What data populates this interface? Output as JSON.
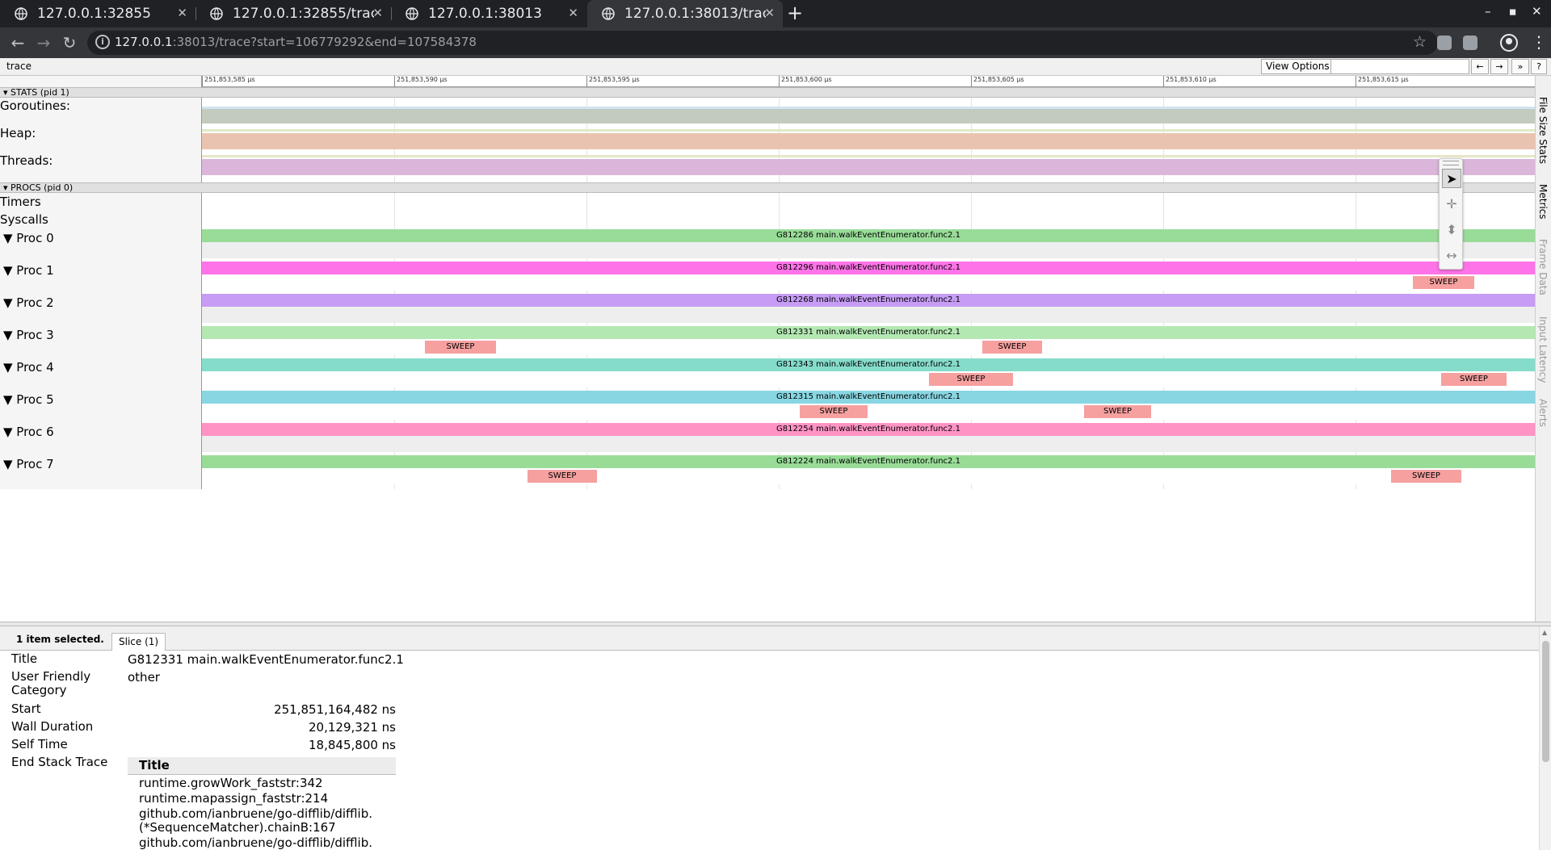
{
  "browser": {
    "tabs": [
      {
        "title": "127.0.0.1:32855",
        "active": false
      },
      {
        "title": "127.0.0.1:32855/trace",
        "active": false
      },
      {
        "title": "127.0.0.1:38013",
        "active": false
      },
      {
        "title": "127.0.0.1:38013/trace",
        "active": true
      }
    ],
    "url_host": "127.0.0.1",
    "url_rest": ":38013/trace?start=106779292&end=107584378"
  },
  "viewer": {
    "title": "trace",
    "view_options_label": "View Options",
    "search_placeholder": "",
    "nav_prev": "←",
    "nav_next": "→",
    "nav_more": "»",
    "help": "?"
  },
  "ruler": {
    "ticks": [
      "251,853,585 µs",
      "251,853,590 µs",
      "251,853,595 µs",
      "251,853,600 µs",
      "251,853,605 µs",
      "251,853,610 µs",
      "251,853,615 µs"
    ]
  },
  "stats": {
    "header": "▾ STATS (pid 1)",
    "goroutines": "Goroutines:",
    "heap": "Heap:",
    "threads": "Threads:"
  },
  "procs": {
    "header": "▾ PROCS (pid 0)",
    "timers": "Timers",
    "syscalls": "Syscalls",
    "sweep_label": "SWEEP",
    "rows": [
      {
        "label": "▼  Proc 0",
        "slice": "G812286 main.walkEventEnumerator.func2.1",
        "color": "#98dc98"
      },
      {
        "label": "▼  Proc 1",
        "slice": "G812296 main.walkEventEnumerator.func2.1",
        "color": "#ff73e8"
      },
      {
        "label": "▼  Proc 2",
        "slice": "G812268 main.walkEventEnumerator.func2.1",
        "color": "#c69cf5"
      },
      {
        "label": "▼  Proc 3",
        "slice": "G812331 main.walkEventEnumerator.func2.1",
        "color": "#b3e8b3"
      },
      {
        "label": "▼  Proc 4",
        "slice": "G812343 main.walkEventEnumerator.func2.1",
        "color": "#86dcca"
      },
      {
        "label": "▼  Proc 5",
        "slice": "G812315 main.walkEventEnumerator.func2.1",
        "color": "#88d6e2"
      },
      {
        "label": "▼  Proc 6",
        "slice": "G812254 main.walkEventEnumerator.func2.1",
        "color": "#ff94c4"
      },
      {
        "label": "▼  Proc 7",
        "slice": "G812224 main.walkEventEnumerator.func2.1",
        "color": "#98dc98"
      }
    ]
  },
  "side_tabs": [
    "File Size Stats",
    "Metrics",
    "Frame Data",
    "Input Latency",
    "Alerts"
  ],
  "analysis": {
    "selected_count": "1 item selected.",
    "tab_label": "Slice (1)",
    "title_label": "Title",
    "title_value": "G812331 main.walkEventEnumerator.func2.1",
    "category_label": "User Friendly Category",
    "category_value": "other",
    "start_label": "Start",
    "start_value": "251,851,164,482 ns",
    "wall_label": "Wall Duration",
    "wall_value": "20,129,321 ns",
    "self_label": "Self Time",
    "self_value": "18,845,800 ns",
    "stack_label": "End Stack Trace",
    "stack_header": "Title",
    "stack_rows": [
      "runtime.growWork_faststr:342",
      "runtime.mapassign_faststr:214",
      "github.com/ianbruene/go-difflib/difflib.(*SequenceMatcher).chainB:167",
      "github.com/ianbruene/go-difflib/difflib."
    ]
  }
}
